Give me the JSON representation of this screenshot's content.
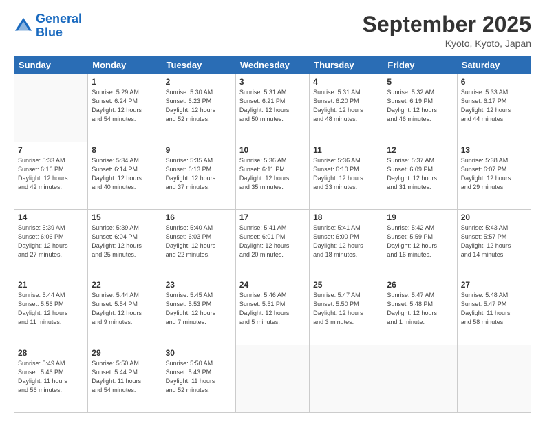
{
  "header": {
    "logo_line1": "General",
    "logo_line2": "Blue",
    "month_title": "September 2025",
    "location": "Kyoto, Kyoto, Japan"
  },
  "weekdays": [
    "Sunday",
    "Monday",
    "Tuesday",
    "Wednesday",
    "Thursday",
    "Friday",
    "Saturday"
  ],
  "weeks": [
    [
      {
        "day": "",
        "info": ""
      },
      {
        "day": "1",
        "info": "Sunrise: 5:29 AM\nSunset: 6:24 PM\nDaylight: 12 hours\nand 54 minutes."
      },
      {
        "day": "2",
        "info": "Sunrise: 5:30 AM\nSunset: 6:23 PM\nDaylight: 12 hours\nand 52 minutes."
      },
      {
        "day": "3",
        "info": "Sunrise: 5:31 AM\nSunset: 6:21 PM\nDaylight: 12 hours\nand 50 minutes."
      },
      {
        "day": "4",
        "info": "Sunrise: 5:31 AM\nSunset: 6:20 PM\nDaylight: 12 hours\nand 48 minutes."
      },
      {
        "day": "5",
        "info": "Sunrise: 5:32 AM\nSunset: 6:19 PM\nDaylight: 12 hours\nand 46 minutes."
      },
      {
        "day": "6",
        "info": "Sunrise: 5:33 AM\nSunset: 6:17 PM\nDaylight: 12 hours\nand 44 minutes."
      }
    ],
    [
      {
        "day": "7",
        "info": "Sunrise: 5:33 AM\nSunset: 6:16 PM\nDaylight: 12 hours\nand 42 minutes."
      },
      {
        "day": "8",
        "info": "Sunrise: 5:34 AM\nSunset: 6:14 PM\nDaylight: 12 hours\nand 40 minutes."
      },
      {
        "day": "9",
        "info": "Sunrise: 5:35 AM\nSunset: 6:13 PM\nDaylight: 12 hours\nand 37 minutes."
      },
      {
        "day": "10",
        "info": "Sunrise: 5:36 AM\nSunset: 6:11 PM\nDaylight: 12 hours\nand 35 minutes."
      },
      {
        "day": "11",
        "info": "Sunrise: 5:36 AM\nSunset: 6:10 PM\nDaylight: 12 hours\nand 33 minutes."
      },
      {
        "day": "12",
        "info": "Sunrise: 5:37 AM\nSunset: 6:09 PM\nDaylight: 12 hours\nand 31 minutes."
      },
      {
        "day": "13",
        "info": "Sunrise: 5:38 AM\nSunset: 6:07 PM\nDaylight: 12 hours\nand 29 minutes."
      }
    ],
    [
      {
        "day": "14",
        "info": "Sunrise: 5:39 AM\nSunset: 6:06 PM\nDaylight: 12 hours\nand 27 minutes."
      },
      {
        "day": "15",
        "info": "Sunrise: 5:39 AM\nSunset: 6:04 PM\nDaylight: 12 hours\nand 25 minutes."
      },
      {
        "day": "16",
        "info": "Sunrise: 5:40 AM\nSunset: 6:03 PM\nDaylight: 12 hours\nand 22 minutes."
      },
      {
        "day": "17",
        "info": "Sunrise: 5:41 AM\nSunset: 6:01 PM\nDaylight: 12 hours\nand 20 minutes."
      },
      {
        "day": "18",
        "info": "Sunrise: 5:41 AM\nSunset: 6:00 PM\nDaylight: 12 hours\nand 18 minutes."
      },
      {
        "day": "19",
        "info": "Sunrise: 5:42 AM\nSunset: 5:59 PM\nDaylight: 12 hours\nand 16 minutes."
      },
      {
        "day": "20",
        "info": "Sunrise: 5:43 AM\nSunset: 5:57 PM\nDaylight: 12 hours\nand 14 minutes."
      }
    ],
    [
      {
        "day": "21",
        "info": "Sunrise: 5:44 AM\nSunset: 5:56 PM\nDaylight: 12 hours\nand 11 minutes."
      },
      {
        "day": "22",
        "info": "Sunrise: 5:44 AM\nSunset: 5:54 PM\nDaylight: 12 hours\nand 9 minutes."
      },
      {
        "day": "23",
        "info": "Sunrise: 5:45 AM\nSunset: 5:53 PM\nDaylight: 12 hours\nand 7 minutes."
      },
      {
        "day": "24",
        "info": "Sunrise: 5:46 AM\nSunset: 5:51 PM\nDaylight: 12 hours\nand 5 minutes."
      },
      {
        "day": "25",
        "info": "Sunrise: 5:47 AM\nSunset: 5:50 PM\nDaylight: 12 hours\nand 3 minutes."
      },
      {
        "day": "26",
        "info": "Sunrise: 5:47 AM\nSunset: 5:48 PM\nDaylight: 12 hours\nand 1 minute."
      },
      {
        "day": "27",
        "info": "Sunrise: 5:48 AM\nSunset: 5:47 PM\nDaylight: 11 hours\nand 58 minutes."
      }
    ],
    [
      {
        "day": "28",
        "info": "Sunrise: 5:49 AM\nSunset: 5:46 PM\nDaylight: 11 hours\nand 56 minutes."
      },
      {
        "day": "29",
        "info": "Sunrise: 5:50 AM\nSunset: 5:44 PM\nDaylight: 11 hours\nand 54 minutes."
      },
      {
        "day": "30",
        "info": "Sunrise: 5:50 AM\nSunset: 5:43 PM\nDaylight: 11 hours\nand 52 minutes."
      },
      {
        "day": "",
        "info": ""
      },
      {
        "day": "",
        "info": ""
      },
      {
        "day": "",
        "info": ""
      },
      {
        "day": "",
        "info": ""
      }
    ]
  ]
}
